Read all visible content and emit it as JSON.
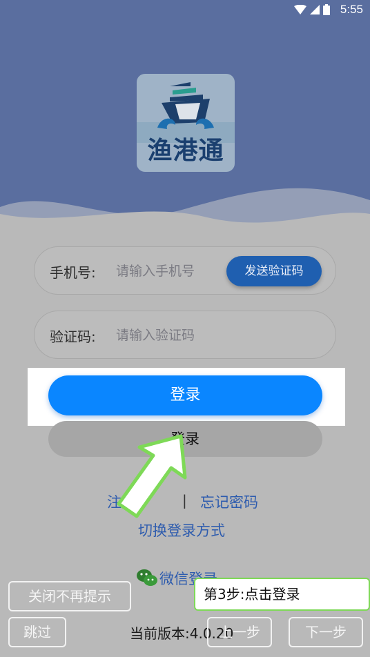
{
  "status_bar": {
    "time": "5:55"
  },
  "logo": {
    "text": "渔港通"
  },
  "form": {
    "phone": {
      "label": "手机号:",
      "placeholder": "请输入手机号"
    },
    "send_code_label": "发送验证码",
    "code": {
      "label": "验证码:",
      "placeholder": "请输入验证码"
    }
  },
  "login_label": "登录",
  "ghost_login_label": "登录",
  "links": {
    "register": "注册",
    "separator": "|",
    "forgot_password": "忘记密码",
    "switch_login": "切换登录方式",
    "wechat_login": "微信登录"
  },
  "version": "当前版本:4.0.20",
  "guide": {
    "close_label": "关闭不再提示",
    "skip_label": "跳过",
    "prev_label": "上一步",
    "next_label": "下一步",
    "tip": "第3步:点击登录"
  },
  "colors": {
    "header": "#5a6e9f",
    "primary": "#0a86ff",
    "send_button": "#1f5fb0",
    "tip_border": "#7ed957"
  }
}
